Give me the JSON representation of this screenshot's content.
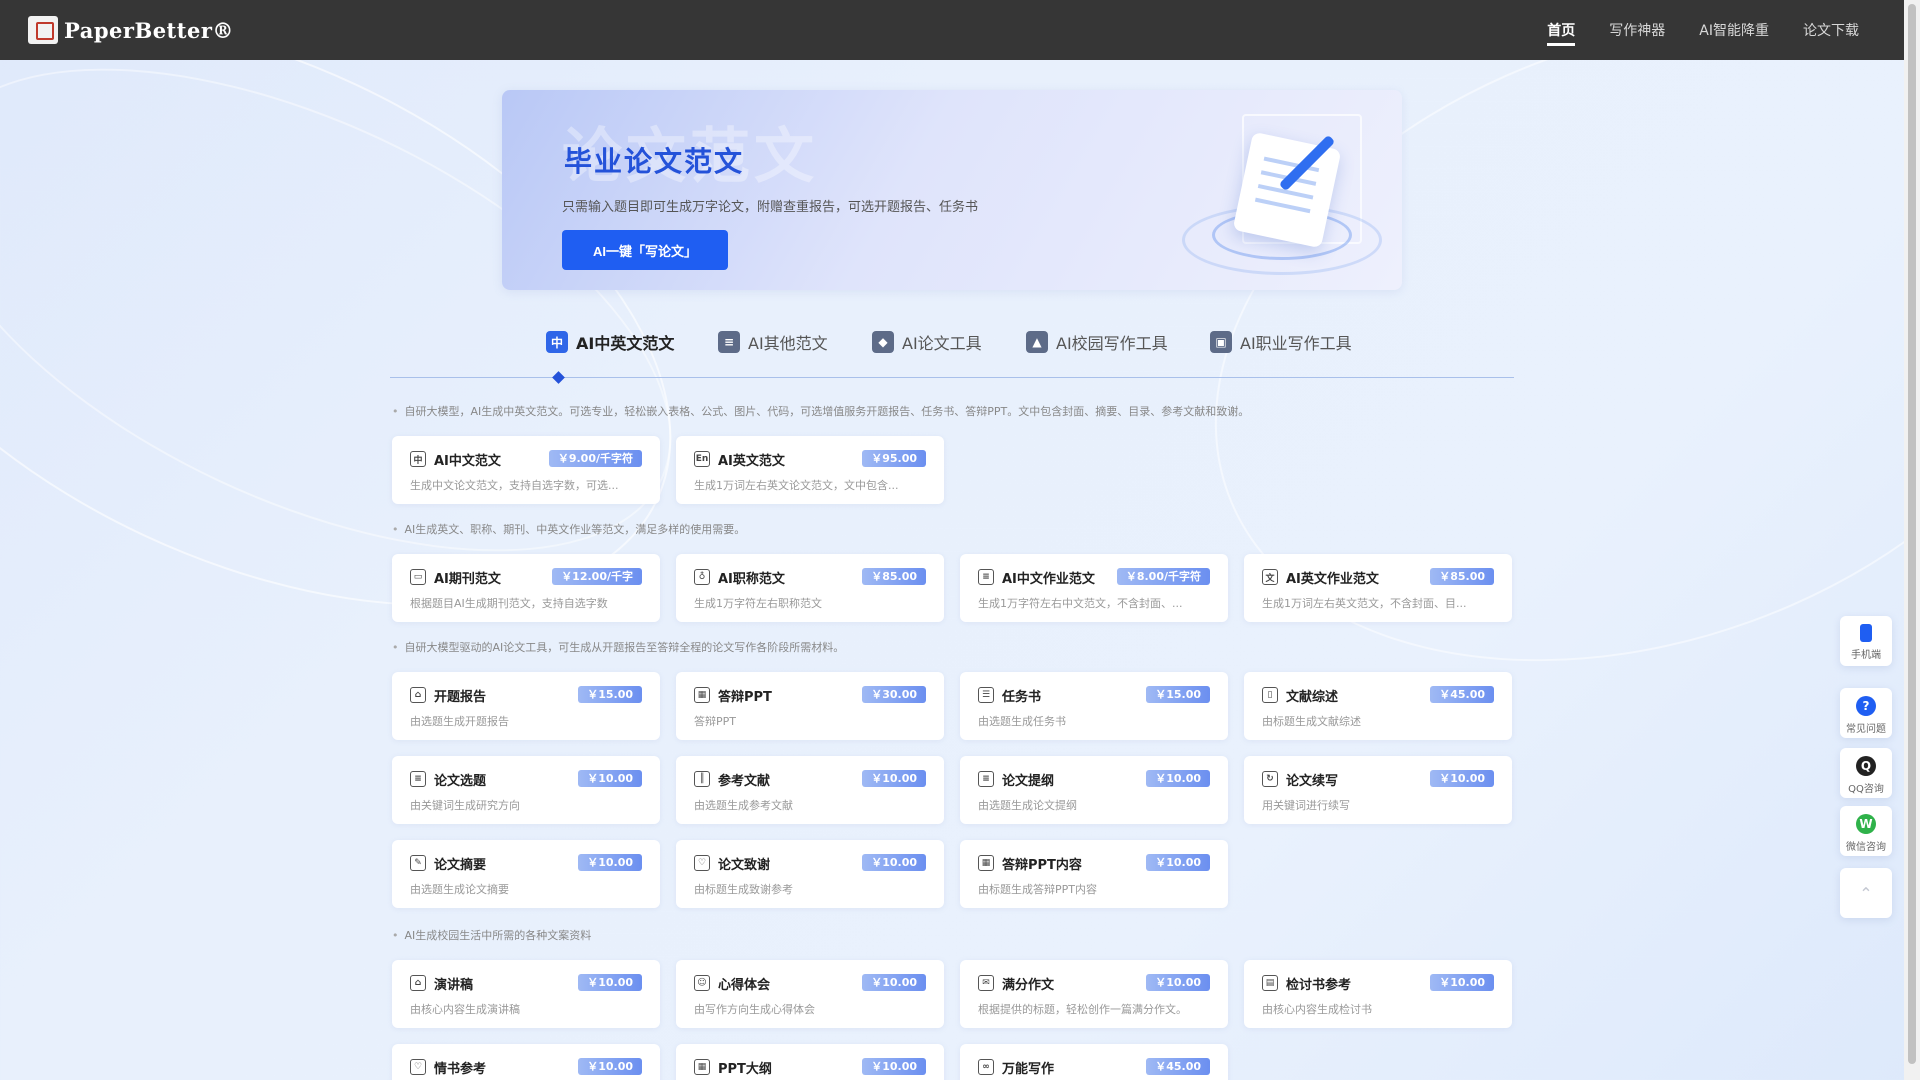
{
  "header": {
    "logo_text": "PaperBetter®",
    "nav": [
      "首页",
      "写作神器",
      "AI智能降重",
      "论文下载"
    ]
  },
  "banner": {
    "bg_text": "论文范文",
    "title": "毕业论文范文",
    "subtitle": "只需输入题目即可生成万字论文，附赠查重报告，可选开题报告、任务书",
    "button": "AI一键「写论文」"
  },
  "tabs": [
    {
      "label": "AI中英文范文",
      "icon": "中"
    },
    {
      "label": "AI其他范文",
      "icon": "≡"
    },
    {
      "label": "AI论文工具",
      "icon": "◆"
    },
    {
      "label": "AI校园写作工具",
      "icon": "▲"
    },
    {
      "label": "AI职业写作工具",
      "icon": "▣"
    }
  ],
  "notes": [
    "自研大模型，AI生成中英文范文。可选专业，轻松嵌入表格、公式、图片、代码，可选增值服务开题报告、任务书、答辩PPT。文中包含封面、摘要、目录、参考文献和致谢。",
    "AI生成英文、职称、期刊、中英文作业等范文，满足多样的使用需要。",
    "自研大模型驱动的AI论文工具，可生成从开题报告至答辩全程的论文写作各阶段所需材料。",
    "AI生成校园生活中所需的各种文案资料"
  ],
  "cards": [
    {
      "title": "AI中文范文",
      "price": "￥9.00/千字符",
      "desc": "生成中文论文范文，支持自选字数，可选...",
      "icon": "中"
    },
    {
      "title": "AI英文范文",
      "price": "￥95.00",
      "desc": "生成1万词左右英文论文范文，文中包含...",
      "icon": "En"
    },
    {
      "title": "AI期刊范文",
      "price": "￥12.00/千字",
      "desc": "根据题目AI生成期刊范文，支持自选字数",
      "icon": "▭"
    },
    {
      "title": "AI职称范文",
      "price": "￥85.00",
      "desc": "生成1万字符左右职称范文",
      "icon": "♁"
    },
    {
      "title": "AI中文作业范文",
      "price": "￥8.00/千字符",
      "desc": "生成1万字符左右中文范文，不含封面、...",
      "icon": "≡"
    },
    {
      "title": "AI英文作业范文",
      "price": "￥85.00",
      "desc": "生成1万词左右英文范文，不含封面、目...",
      "icon": "文"
    },
    {
      "title": "开题报告",
      "price": "￥15.00",
      "desc": "由选题生成开题报告",
      "icon": "⌂"
    },
    {
      "title": "答辩PPT",
      "price": "￥30.00",
      "desc": "答辩PPT",
      "icon": "▦"
    },
    {
      "title": "任务书",
      "price": "￥15.00",
      "desc": "由选题生成任务书",
      "icon": "☰"
    },
    {
      "title": "文献综述",
      "price": "￥45.00",
      "desc": "由标题生成文献综述",
      "icon": "▯"
    },
    {
      "title": "论文选题",
      "price": "￥10.00",
      "desc": "由关键词生成研究方向",
      "icon": "≡"
    },
    {
      "title": "参考文献",
      "price": "￥10.00",
      "desc": "由选题生成参考文献",
      "icon": "║"
    },
    {
      "title": "论文提纲",
      "price": "￥10.00",
      "desc": "由选题生成论文提纲",
      "icon": "≡"
    },
    {
      "title": "论文续写",
      "price": "￥10.00",
      "desc": "用关键词进行续写",
      "icon": "↻"
    },
    {
      "title": "论文摘要",
      "price": "￥10.00",
      "desc": "由选题生成论文摘要",
      "icon": "✎"
    },
    {
      "title": "论文致谢",
      "price": "￥10.00",
      "desc": "由标题生成致谢参考",
      "icon": "♡"
    },
    {
      "title": "答辩PPT内容",
      "price": "￥10.00",
      "desc": "由标题生成答辩PPT内容",
      "icon": "▦"
    },
    {
      "title": "演讲稿",
      "price": "￥10.00",
      "desc": "由核心内容生成演讲稿",
      "icon": "⌂"
    },
    {
      "title": "心得体会",
      "price": "￥10.00",
      "desc": "由写作方向生成心得体会",
      "icon": "☺"
    },
    {
      "title": "满分作文",
      "price": "￥10.00",
      "desc": "根据提供的标题，轻松创作一篇满分作文。",
      "icon": "✉"
    },
    {
      "title": "检讨书参考",
      "price": "￥10.00",
      "desc": "由核心内容生成检讨书",
      "icon": "▤"
    },
    {
      "title": "情书参考",
      "price": "￥10.00",
      "desc": "",
      "icon": "♡"
    },
    {
      "title": "PPT大纲",
      "price": "￥10.00",
      "desc": "",
      "icon": "▦"
    },
    {
      "title": "万能写作",
      "price": "￥45.00",
      "desc": "",
      "icon": "∞"
    }
  ],
  "sidebar": [
    {
      "label": "手机端",
      "icon": "phone-icon"
    },
    {
      "label": "常见问题",
      "icon": "question-icon"
    },
    {
      "label": "QQ咨询",
      "icon": "qq-icon"
    },
    {
      "label": "微信咨询",
      "icon": "wechat-icon"
    },
    {
      "label": "",
      "icon": "back-to-top-icon"
    }
  ],
  "colors": {
    "accent": "#2452d9",
    "button": "#1f5ef2",
    "header_bg": "#363636"
  }
}
